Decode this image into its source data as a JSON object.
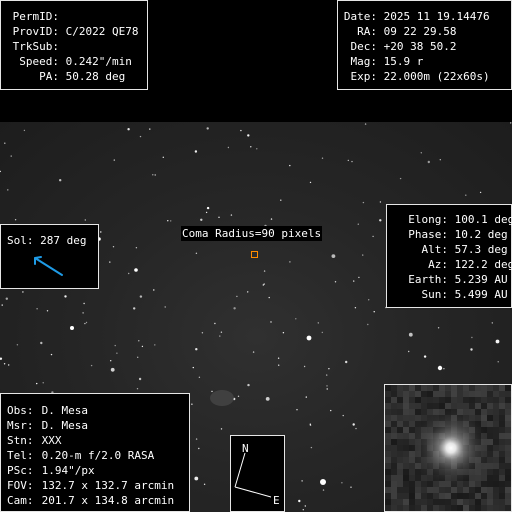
{
  "ident": {
    "permid_label": "PermID:",
    "permid_value": "",
    "provid_label": "ProvID:",
    "provid_value": "C/2022 QE78",
    "trksub_label": "TrkSub:",
    "trksub_value": "",
    "speed_label": "Speed:",
    "speed_value": "0.242\"/min",
    "pa_label": "PA:",
    "pa_value": "50.28 deg"
  },
  "observation": {
    "date_label": "Date:",
    "date_value": "2025 11 19.14476",
    "ra_label": "RA:",
    "ra_value": "09 22 29.58",
    "dec_label": "Dec:",
    "dec_value": "+20 38 50.2",
    "mag_label": "Mag:",
    "mag_value": "15.9 r",
    "exp_label": "Exp:",
    "exp_value": "22.000m (22x60s)"
  },
  "sol": {
    "label": "Sol:",
    "value": "287 deg",
    "arrow_color": "#1e9be6"
  },
  "coma": {
    "label": "Coma Radius=90 pixels",
    "marker_color": "#ff8c00"
  },
  "geometry": {
    "elong_label": "Elong:",
    "elong_value": "100.1 deg",
    "phase_label": "Phase:",
    "phase_value": "10.2 deg",
    "alt_label": "Alt:",
    "alt_value": "57.3 deg",
    "az_label": "Az:",
    "az_value": "122.2 deg",
    "earth_label": "Earth:",
    "earth_value": "5.239 AU",
    "sun_label": "Sun:",
    "sun_value": "5.499 AU"
  },
  "site": {
    "obs_label": "Obs:",
    "obs_value": "D. Mesa",
    "msr_label": "Msr:",
    "msr_value": "D. Mesa",
    "stn_label": "Stn:",
    "stn_value": "XXX",
    "tel_label": "Tel:",
    "tel_value": "0.20-m f/2.0 RASA",
    "psc_label": "PSc:",
    "psc_value": "1.94\"/px",
    "fov_label": "FOV:",
    "fov_value": "132.7 x 132.7 arcmin",
    "cam_label": "Cam:",
    "cam_value": "201.7 x 134.8 arcmin"
  },
  "compass": {
    "north": "N",
    "east": "E"
  },
  "colors": {
    "background": "#000000",
    "sky": "#262626",
    "panel_border": "#e6e6e6",
    "text": "#ffffff"
  }
}
